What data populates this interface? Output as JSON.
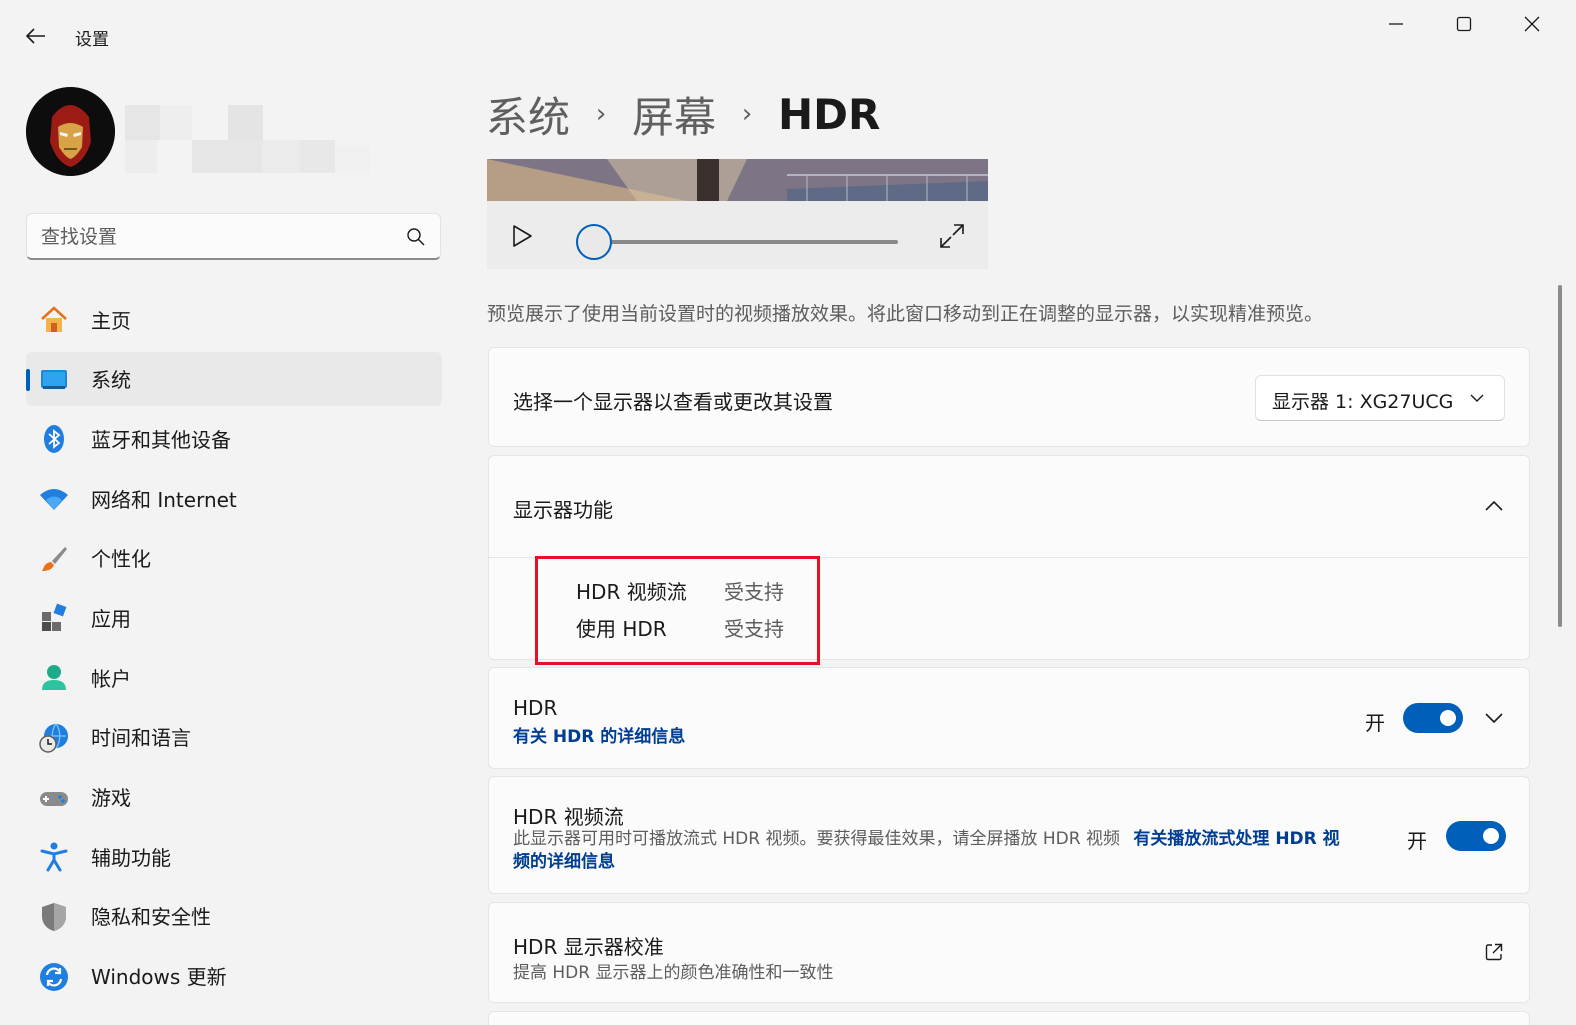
{
  "app": {
    "title": "设置"
  },
  "search": {
    "placeholder": "查找设置"
  },
  "nav": {
    "items": [
      {
        "label": "主页",
        "icon": "home-icon"
      },
      {
        "label": "系统",
        "icon": "system-icon",
        "active": true
      },
      {
        "label": "蓝牙和其他设备",
        "icon": "bluetooth-icon"
      },
      {
        "label": "网络和 Internet",
        "icon": "wifi-icon"
      },
      {
        "label": "个性化",
        "icon": "brush-icon"
      },
      {
        "label": "应用",
        "icon": "apps-icon"
      },
      {
        "label": "帐户",
        "icon": "account-icon"
      },
      {
        "label": "时间和语言",
        "icon": "globe-clock-icon"
      },
      {
        "label": "游戏",
        "icon": "gamepad-icon"
      },
      {
        "label": "辅助功能",
        "icon": "accessibility-icon"
      },
      {
        "label": "隐私和安全性",
        "icon": "shield-icon"
      },
      {
        "label": "Windows 更新",
        "icon": "update-icon"
      }
    ]
  },
  "breadcrumb": {
    "level1": "系统",
    "level2": "屏幕",
    "current": "HDR",
    "separator": "›"
  },
  "video": {
    "progress": 0
  },
  "preview_note": "预览展示了使用当前设置时的视频播放效果。将此窗口移动到正在调整的显示器，以实现精准预览。",
  "display_select": {
    "label": "选择一个显示器以查看或更改其设置",
    "value": "显示器 1: XG27UCG"
  },
  "display_features": {
    "title": "显示器功能",
    "rows": [
      {
        "name": "HDR 视频流",
        "value": "受支持"
      },
      {
        "name": "使用 HDR",
        "value": "受支持"
      }
    ]
  },
  "hdr": {
    "title": "HDR",
    "link": "有关 HDR 的详细信息",
    "state_label": "开",
    "on": true
  },
  "hdr_stream": {
    "title": "HDR 视频流",
    "desc": "此显示器可用时可播放流式 HDR 视频。要获得最佳效果，请全屏播放 HDR 视频",
    "link_line1": "有关播放流式处理 HDR 视",
    "link_line2": "频的详细信息",
    "state_label": "开",
    "on": true
  },
  "calibration": {
    "title": "HDR 显示器校准",
    "desc": "提高 HDR 显示器上的颜色准确性和一致性"
  },
  "colors": {
    "accent": "#005fb8",
    "highlight": "#e81123",
    "link": "#003e92"
  }
}
